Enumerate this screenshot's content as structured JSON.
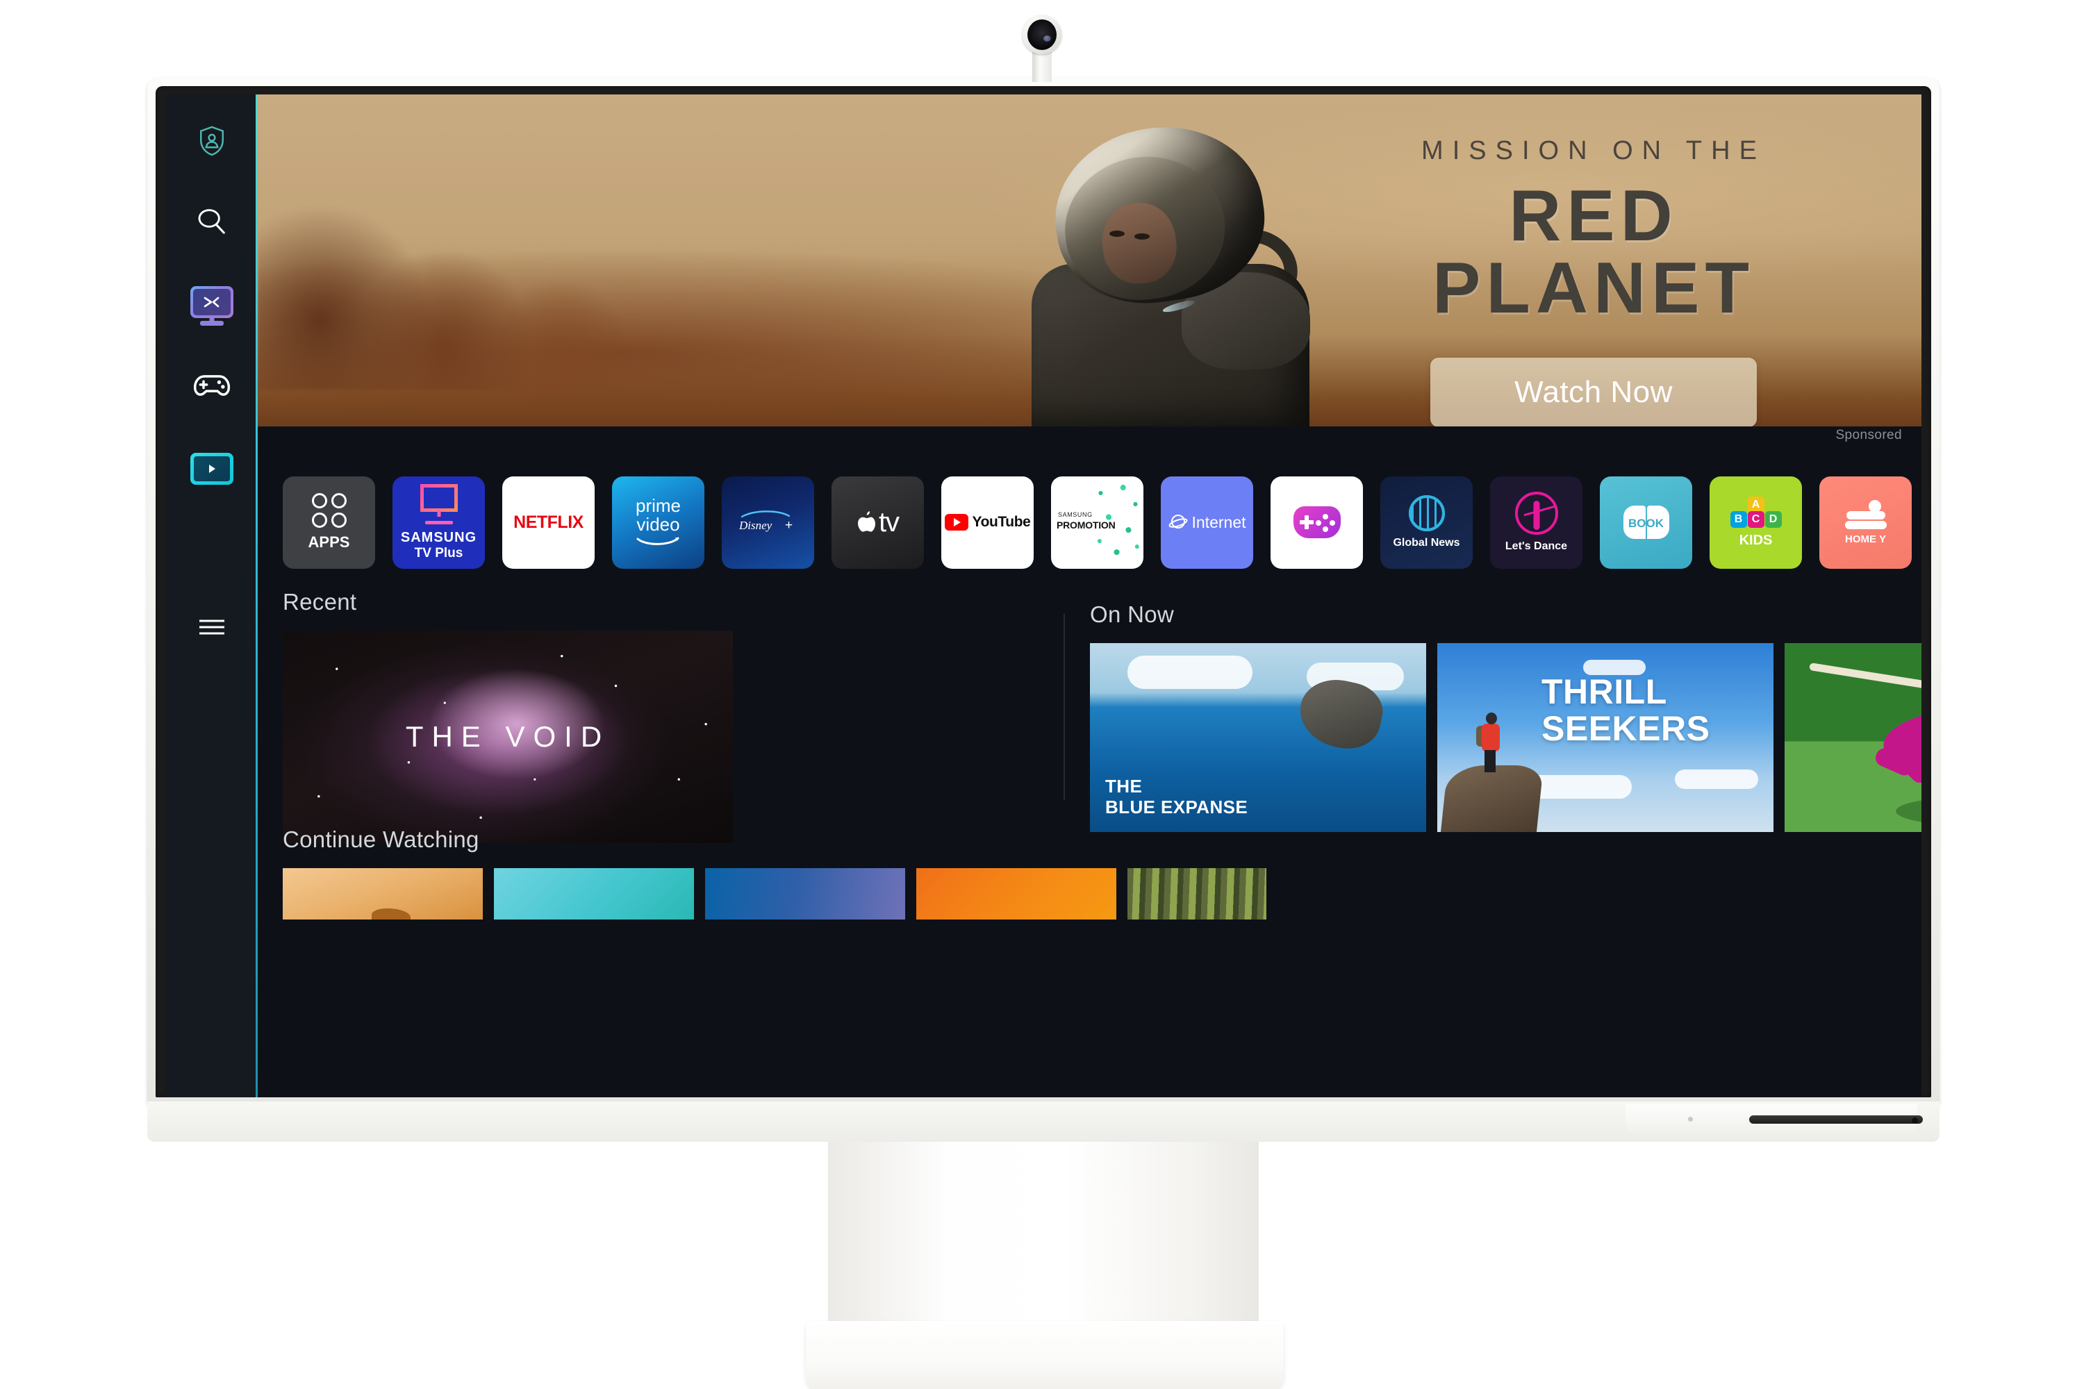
{
  "device": {
    "name": "Samsung Smart Monitor",
    "webcam_label": "slimfit-webcam",
    "stand_label": "monitor-stand"
  },
  "sidebar": {
    "items": [
      {
        "id": "profile",
        "icon": "profile-shield-icon",
        "label": "Profile"
      },
      {
        "id": "search",
        "icon": "search-icon",
        "label": "Search"
      },
      {
        "id": "tvplus",
        "icon": "samsung-tv-plus-icon",
        "label": "Samsung TV Plus"
      },
      {
        "id": "gaming",
        "icon": "gamepad-icon",
        "label": "Gaming Hub"
      },
      {
        "id": "media",
        "icon": "media-play-icon",
        "label": "Media"
      },
      {
        "id": "menu",
        "icon": "hamburger-menu-icon",
        "label": "Menu"
      }
    ]
  },
  "hero": {
    "subtitle": "MISSION ON THE",
    "title": "RED PLANET",
    "cta_label": "Watch Now",
    "sponsored_label": "Sponsored"
  },
  "apps": [
    {
      "id": "apps",
      "label": "APPS",
      "sublabel": ""
    },
    {
      "id": "samsung_tv",
      "label": "SAMSUNG",
      "sublabel": "TV Plus"
    },
    {
      "id": "netflix",
      "label": "NETFLIX",
      "sublabel": ""
    },
    {
      "id": "prime_video",
      "label": "prime",
      "sublabel": "video"
    },
    {
      "id": "disney",
      "label": "Disney+",
      "sublabel": ""
    },
    {
      "id": "apple_tv",
      "label": "tv",
      "sublabel": ""
    },
    {
      "id": "youtube",
      "label": "YouTube",
      "sublabel": ""
    },
    {
      "id": "promotion",
      "label": "SAMSUNG",
      "sublabel": "PROMOTION"
    },
    {
      "id": "internet",
      "label": "Internet",
      "sublabel": ""
    },
    {
      "id": "gaming_hub",
      "label": "",
      "sublabel": ""
    },
    {
      "id": "global_news",
      "label": "Global News",
      "sublabel": ""
    },
    {
      "id": "lets_dance",
      "label": "Let's Dance",
      "sublabel": ""
    },
    {
      "id": "book",
      "label": "BOOK",
      "sublabel": ""
    },
    {
      "id": "kids",
      "label": "KIDS",
      "sublabel": "A B C D"
    },
    {
      "id": "home_yoga",
      "label": "HOME Y",
      "sublabel": ""
    }
  ],
  "rows": {
    "recent": {
      "title": "Recent",
      "card_title": "THE VOID"
    },
    "on_now": {
      "title": "On Now",
      "cards": [
        {
          "id": "blue_expanse",
          "line1": "THE",
          "line2": "BLUE EXPANSE"
        },
        {
          "id": "thrill_seekers",
          "line1": "THRILL",
          "line2": "SEEKERS"
        },
        {
          "id": "dog_cartoon",
          "line1": "",
          "line2": ""
        },
        {
          "id": "tuna_fish",
          "line1": "",
          "line2": ""
        }
      ]
    },
    "continue_watching": {
      "title": "Continue Watching",
      "cards": [
        {
          "id": "desert"
        },
        {
          "id": "teal"
        },
        {
          "id": "blue_purple"
        },
        {
          "id": "orange"
        },
        {
          "id": "forest"
        }
      ]
    }
  },
  "colors": {
    "screen_bg": "#0d1117",
    "sidebar_bg": "#141a1f",
    "accent_teal": "#3cbfd8",
    "netflix_red": "#e50914",
    "youtube_red": "#ff0000",
    "samsung_blue": "#1f2fbb",
    "kids_green": "#a8d92b",
    "text_primary": "#d4d8dc",
    "text_muted": "#8b9097"
  }
}
